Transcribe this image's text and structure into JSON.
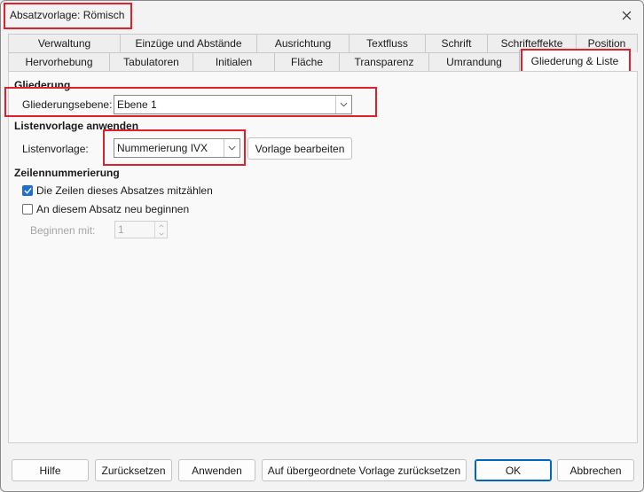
{
  "window": {
    "title": "Absatzvorlage: Römisch"
  },
  "tabs_row1": [
    "Verwaltung",
    "Einzüge und Abstände",
    "Ausrichtung",
    "Textfluss",
    "Schrift",
    "Schrifteffekte",
    "Position"
  ],
  "tabs_row2": [
    "Hervorhebung",
    "Tabulatoren",
    "Initialen",
    "Fläche",
    "Transparenz",
    "Umrandung",
    "Gliederung & Liste"
  ],
  "active_tab": "Gliederung & Liste",
  "gliederung": {
    "section_title": "Gliederung",
    "level_label": "Gliederungsebene:",
    "level_value": "Ebene 1"
  },
  "listenvorlage": {
    "section_title": "Listenvorlage anwenden",
    "label": "Listenvorlage:",
    "value": "Nummerierung IVX",
    "edit_button": "Vorlage bearbeiten"
  },
  "zeilennummerierung": {
    "section_title": "Zeilennummerierung",
    "count_lines_label": "Die Zeilen dieses Absatzes mitzählen",
    "count_lines_checked": true,
    "restart_label": "An diesem Absatz neu beginnen",
    "restart_checked": false,
    "start_with_label": "Beginnen mit:",
    "start_with_value": "1"
  },
  "buttons": {
    "help": "Hilfe",
    "reset": "Zurücksetzen",
    "apply": "Anwenden",
    "reset_parent": "Auf übergeordnete Vorlage zurücksetzen",
    "ok": "OK",
    "cancel": "Abbrechen"
  },
  "colors": {
    "accent": "#0067c0",
    "highlight": "#e0202a",
    "checkbox": "#1f6fd1"
  },
  "icons": {
    "close": "close-icon",
    "dropdown": "chevron-down-icon",
    "spin_up": "chevron-up-icon",
    "spin_down": "chevron-down-icon",
    "check": "check-icon"
  }
}
